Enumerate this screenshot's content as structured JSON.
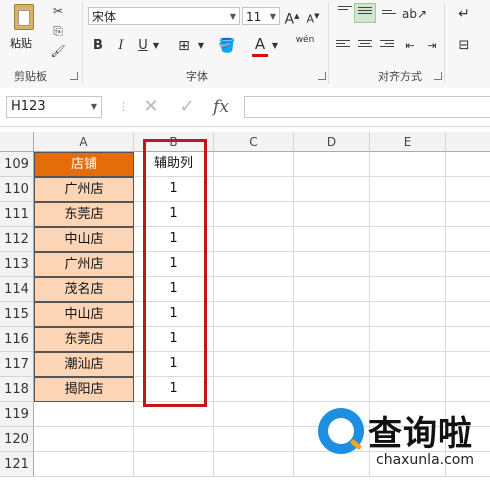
{
  "ribbon": {
    "clipboard": {
      "paste_label": "粘贴",
      "group_label": "剪贴板"
    },
    "font": {
      "name": "宋体",
      "size": "11",
      "group_label": "字体",
      "bold": "B",
      "italic": "I",
      "underline": "U",
      "grow": "A",
      "shrink": "A",
      "font_color": "A",
      "phonetic": "wén"
    },
    "alignment": {
      "group_label": "对齐方式"
    }
  },
  "formula_bar": {
    "name_box": "H123",
    "fx": "fx",
    "cancel": "✕",
    "confirm": "✓",
    "formula": ""
  },
  "columns": [
    "A",
    "B",
    "C",
    "D",
    "E"
  ],
  "rows": [
    {
      "num": "109",
      "a": "店铺",
      "b": "辅助列"
    },
    {
      "num": "110",
      "a": "广州店",
      "b": "1"
    },
    {
      "num": "111",
      "a": "东莞店",
      "b": "1"
    },
    {
      "num": "112",
      "a": "中山店",
      "b": "1"
    },
    {
      "num": "113",
      "a": "广州店",
      "b": "1"
    },
    {
      "num": "114",
      "a": "茂名店",
      "b": "1"
    },
    {
      "num": "115",
      "a": "中山店",
      "b": "1"
    },
    {
      "num": "116",
      "a": "东莞店",
      "b": "1"
    },
    {
      "num": "117",
      "a": "潮汕店",
      "b": "1"
    },
    {
      "num": "118",
      "a": "揭阳店",
      "b": "1"
    },
    {
      "num": "119",
      "a": "",
      "b": ""
    },
    {
      "num": "120",
      "a": "",
      "b": ""
    },
    {
      "num": "121",
      "a": "",
      "b": ""
    }
  ],
  "watermark": {
    "title": "查询啦",
    "domain": "chaxunla.com"
  },
  "colors": {
    "header_fill": "#e46c0a",
    "store_fill": "#fbd5b5",
    "highlight": "#c0161d"
  }
}
